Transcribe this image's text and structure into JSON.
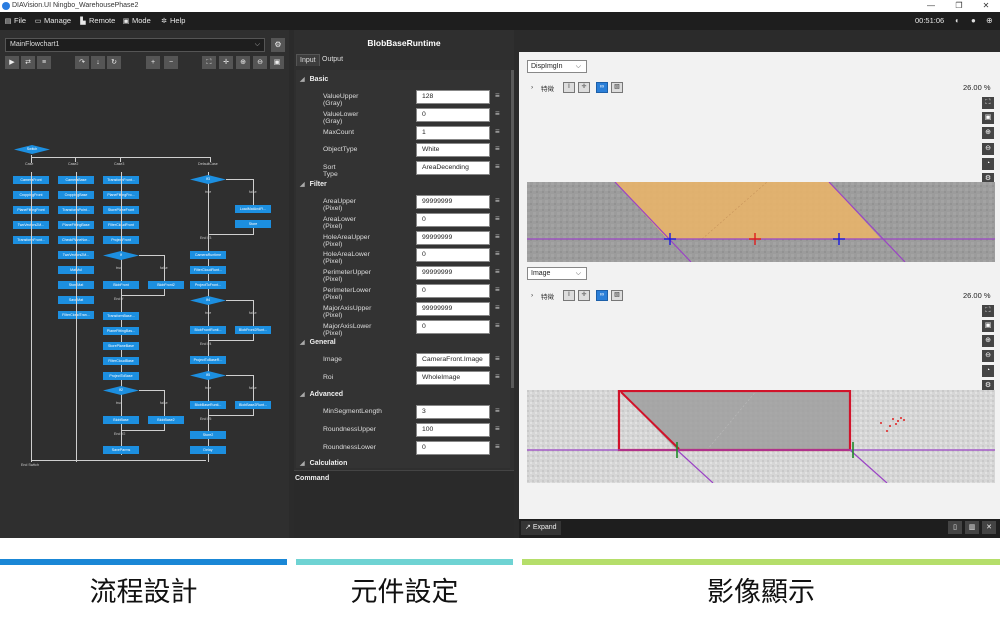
{
  "window": {
    "title": "DIAVision.UI Ningbo_WarehousePhase2",
    "controls": [
      "—",
      "❐",
      "✕"
    ]
  },
  "menubar": {
    "items": [
      {
        "label": "File",
        "icon": "file-icon"
      },
      {
        "label": "Manage",
        "icon": "monitor-icon"
      },
      {
        "label": "Remote",
        "icon": "remote-icon"
      },
      {
        "label": "Mode",
        "icon": "mode-icon"
      },
      {
        "label": "Help",
        "icon": "gear-icon"
      }
    ],
    "clock": "00:51:06"
  },
  "flowchart": {
    "selected": "MainFlowchart1",
    "nodes": {
      "switch": "Switch",
      "case": "Case",
      "case2": "Case2",
      "case3": "Case3",
      "default": "DefaultCase",
      "c1": [
        "CameraFront",
        "CroppingFront",
        "PlaneFittingFront",
        "TwoVectors2M...",
        "TransformFront..."
      ],
      "c2": [
        "CameraBase",
        "CroppingBase",
        "TransformPoint...",
        "PlaneFittingBase",
        "CheckPlaneNor...",
        "TwoVectors2M...",
        "MatMul",
        "StoreMat",
        "SaveMat",
        "FilterCloudTran..."
      ],
      "c3": [
        "TransformFront...",
        "PlaneFittingFro...",
        "StorePlaneFront",
        "FilterCloudFront",
        "ProjectFront"
      ],
      "if1": "If",
      "if1_true": [
        "BlobFront"
      ],
      "if1_false": [
        "BlobFront2"
      ],
      "endif1": "End If",
      "c3b": [
        "TransformBase...",
        "PlaneFittingBas...",
        "StorePlaneBase",
        "FilterCloudBase",
        "ProjectToBase"
      ],
      "if2": "If2",
      "if2_true": [
        "BlobBase"
      ],
      "if2_false": [
        "BlobBase2"
      ],
      "endif2": "End If2",
      "saveparms": "SaveParms",
      "if3": "If3",
      "if3_false": [
        "LoadMatAndFi...",
        "Store"
      ],
      "endif3": "End If3",
      "d1": [
        "CameraRuntime",
        "FilterCloudRunt...",
        "ProjectToFront..."
      ],
      "if4": "If4",
      "if4_true": [
        "BlobFrontRunti..."
      ],
      "if4_false": [
        "BlobFront2Runt..."
      ],
      "endif4": "End If4",
      "d2": [
        "ProjectToBaseR..."
      ],
      "if5": "If5",
      "if5_true": [
        "BlobBaseRunti..."
      ],
      "if5_false": [
        "BlobBase2Runt..."
      ],
      "endif5": "End If5",
      "d3": [
        "Store2",
        "Delay"
      ],
      "endswitch": "End Switch",
      "t": "true",
      "f": "false"
    }
  },
  "component": {
    "title": "BlobBaseRuntime",
    "tabs": [
      "Input",
      "Output"
    ],
    "sections": [
      {
        "name": "Basic",
        "props": [
          {
            "label": "ValueUpper (Gray)",
            "value": "128"
          },
          {
            "label": "ValueLower (Gray)",
            "value": "0"
          },
          {
            "label": "MaxCount",
            "value": "1"
          },
          {
            "label": "ObjectType",
            "value": "White"
          },
          {
            "label": "Sort Type",
            "value": "AreaDecending"
          }
        ]
      },
      {
        "name": "Filter",
        "props": [
          {
            "label": "AreaUpper (Pixel)",
            "value": "99999999"
          },
          {
            "label": "AreaLower (Pixel)",
            "value": "0"
          },
          {
            "label": "HoleAreaUpper (Pixel)",
            "value": "99999999"
          },
          {
            "label": "HoleAreaLower (Pixel)",
            "value": "0"
          },
          {
            "label": "PerimeterUpper (Pixel)",
            "value": "99999999"
          },
          {
            "label": "PerimeterLower (Pixel)",
            "value": "0"
          },
          {
            "label": "MajorAxisUpper (Pixel)",
            "value": "99999999"
          },
          {
            "label": "MajorAxisLower (Pixel)",
            "value": "0"
          }
        ]
      },
      {
        "name": "General",
        "props": [
          {
            "label": "Image",
            "value": "CameraFront.Image"
          },
          {
            "label": "Roi",
            "value": "WholeImage"
          }
        ]
      },
      {
        "name": "Advanced",
        "props": [
          {
            "label": "MinSegmentLength",
            "value": "3"
          },
          {
            "label": "RoundnessUpper",
            "value": "100"
          },
          {
            "label": "RoundnessLower",
            "value": "0"
          }
        ]
      },
      {
        "name": "Calculation",
        "props": []
      }
    ],
    "command_label": "Command"
  },
  "viewer": {
    "top": {
      "select": "DispImgIn",
      "feature_label": "特徵",
      "zoom": "26.00 %"
    },
    "bottom": {
      "select": "Image",
      "feature_label": "特徵",
      "zoom": "26.00 %"
    },
    "expand_label": "Expand"
  },
  "captions": [
    {
      "text": "流程設計",
      "color": "#1a87d6"
    },
    {
      "text": "元件設定",
      "color": "#6fd3d3"
    },
    {
      "text": "影像顯示",
      "color": "#b5de6a"
    }
  ]
}
